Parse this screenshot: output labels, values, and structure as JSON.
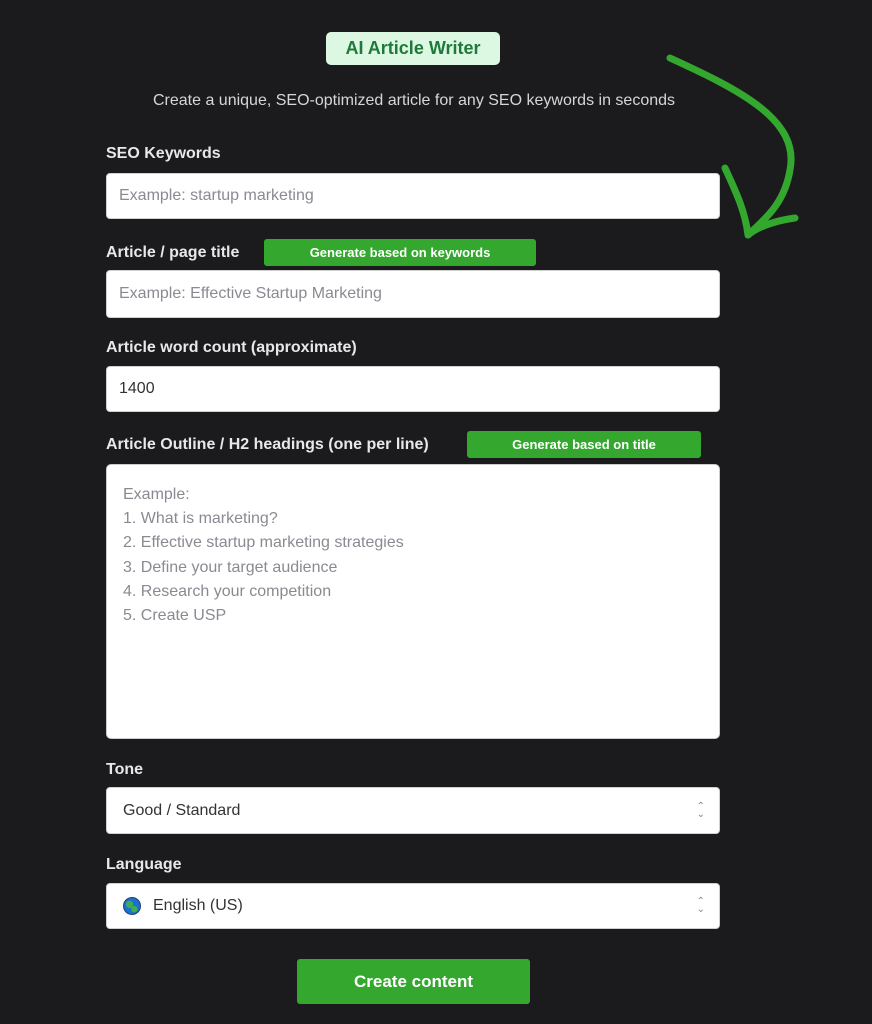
{
  "header": {
    "badge": "AI Article Writer",
    "subtitle": "Create a unique, SEO-optimized article for any SEO keywords in seconds"
  },
  "keywords": {
    "label": "SEO Keywords",
    "placeholder": "Example: startup marketing"
  },
  "title": {
    "label": "Article / page title",
    "generate_label": "Generate based on keywords",
    "placeholder": "Example: Effective Startup Marketing"
  },
  "word_count": {
    "label": "Article word count (approximate)",
    "value": "1400"
  },
  "outline": {
    "label": "Article Outline / H2 headings (one per line)",
    "generate_label": "Generate based on title",
    "placeholder_lines": [
      "Example:",
      "1. What is marketing?",
      "2. Effective startup marketing strategies",
      "3. Define your target audience",
      "4. Research your competition",
      "5. Create USP"
    ]
  },
  "tone": {
    "label": "Tone",
    "selected": "Good / Standard"
  },
  "language": {
    "label": "Language",
    "icon": "globe-icon",
    "selected": "English (US)"
  },
  "submit_label": "Create content",
  "colors": {
    "accent_green": "#33a72e",
    "badge_bg": "#dcf8e3",
    "badge_text": "#1f7a3a",
    "background": "#1b1b1d"
  }
}
